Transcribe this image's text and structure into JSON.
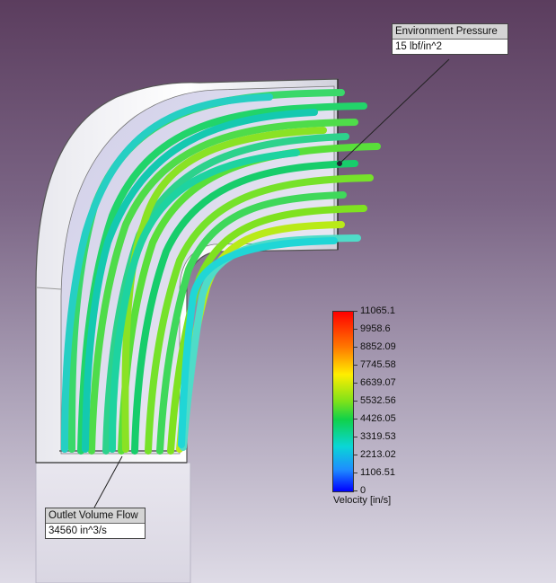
{
  "callouts": {
    "environment_pressure": {
      "title": "Environment Pressure",
      "value": "15 lbf/in^2"
    },
    "outlet_volume_flow": {
      "title": "Outlet Volume Flow",
      "value": "34560 in^3/s"
    }
  },
  "legend": {
    "title": "Velocity [in/s]",
    "ticks": [
      "11065.1",
      "9958.6",
      "8852.09",
      "7745.58",
      "6639.07",
      "5532.56",
      "4426.05",
      "3319.53",
      "2213.02",
      "1106.51",
      "0"
    ],
    "colors": {
      "max": "#ff0000",
      "high": "#ffee00",
      "mid": "#10d14a",
      "low": "#0ad6d6",
      "min": "#0000ff"
    }
  }
}
